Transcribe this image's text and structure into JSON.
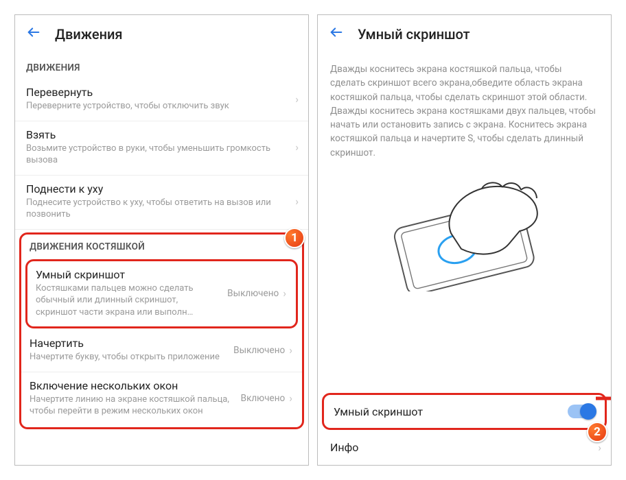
{
  "left": {
    "title": "Движения",
    "section1": "ДВИЖЕНИЯ",
    "flip": {
      "title": "Перевернуть",
      "desc": "Переверните устройство, чтобы отключить звук"
    },
    "pickup": {
      "title": "Взять",
      "desc": "Возьмите устройство в руки, чтобы уменьшить громкость вызова"
    },
    "ear": {
      "title": "Поднести к уху",
      "desc": "Поднесите устройство к уху, чтобы ответить на вызов или позвонить"
    },
    "section2": "ДВИЖЕНИЯ КОСТЯШКОЙ",
    "smart": {
      "title": "Умный скриншот",
      "desc": "Костяшками пальцев можно сделать обычный или длинный скриншот, скриншот части экрана или выполн…",
      "value": "Выключено"
    },
    "draw": {
      "title": "Начертить",
      "desc": "Начертите букву, чтобы открыть приложение",
      "value": "Выключено"
    },
    "multi": {
      "title": "Включение нескольких окон",
      "desc": "Начертите линию на экране костяшкой пальца, чтобы перейти в режим нескольких окон",
      "value": "Включено"
    }
  },
  "right": {
    "title": "Умный скриншот",
    "info": "Дважды коснитесь экрана костяшкой пальца, чтобы сделать скриншот всего экрана,обведите область экрана костяшкой пальца, чтобы сделать скриншот этой области. Дважды коснитесь экрана костяшками двух пальцев, чтобы начать или остановить запись с экрана. Коснитесь экрана костяшкой пальца и начертите S, чтобы сделать длинный скриншот.",
    "toggleLabel": "Умный скриншот",
    "infoRow": "Инфо"
  },
  "badges": {
    "one": "1",
    "two": "2"
  }
}
